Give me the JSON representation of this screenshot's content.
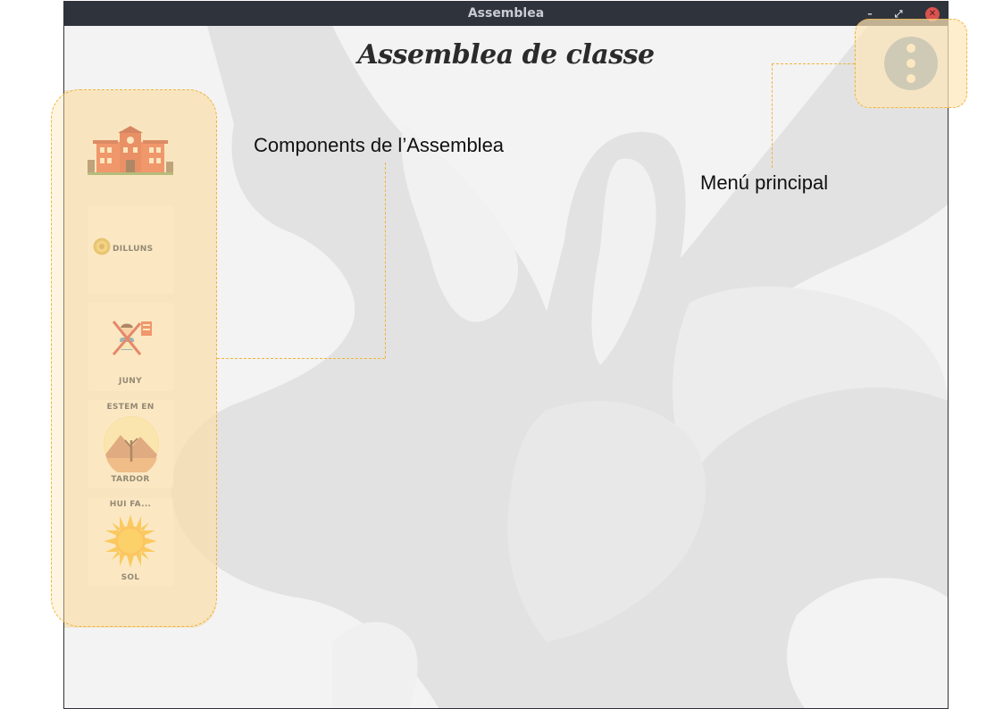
{
  "window": {
    "title": "Assemblea",
    "controls": {
      "minimize": "–",
      "maximize": "⤢",
      "close": "✕"
    }
  },
  "app": {
    "title": "Assemblea de classe",
    "menu_icon": "vertical-dots-icon"
  },
  "sidebar": {
    "logo_icon": "school-building-icon",
    "day": {
      "label": "DILLUNS",
      "icon": "coin-icon"
    },
    "month": {
      "label": "JUNY",
      "icon": "no-school-child-icon"
    },
    "season": {
      "caption": "ESTEM EN",
      "label": "TARDOR",
      "icon": "autumn-tree-icon"
    },
    "weather": {
      "caption": "HUI FA...",
      "label": "SOL",
      "icon": "sun-icon"
    }
  },
  "annotations": {
    "components": "Components de l’Assemblea",
    "menu": "Menú principal"
  },
  "colors": {
    "titlebar": "#2f333b",
    "menu_button": "#5b86b3",
    "highlight_border": "#f0b43c",
    "sidebar": "#f0d69e"
  }
}
